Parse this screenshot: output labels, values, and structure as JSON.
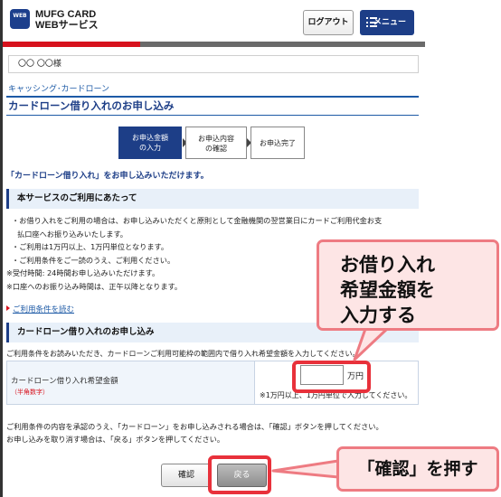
{
  "header": {
    "logo_badge": "WEB",
    "logo_line1": "MUFG CARD",
    "logo_line2": "WEBサービス",
    "logout_label": "ログアウト",
    "menu_label": "メニュー"
  },
  "user": {
    "name": "〇〇 〇〇様"
  },
  "breadcrumb": "キャッシング･カードローン",
  "page_title": "カードローン借り入れのお申し込み",
  "steps": [
    {
      "line1": "お申込金額",
      "line2": "の入力"
    },
    {
      "line1": "お申込内容",
      "line2": "の確認"
    },
    {
      "line1": "お申込完了",
      "line2": ""
    }
  ],
  "intro": "「カードローン借り入れ」をお申し込みいただけます。",
  "section1_title": "本サービスのご利用にあたって",
  "notes": [
    "・お借り入れをご利用の場合は、お申し込みいただくと原則として金融機関の翌営業日にカードご利用代金お支",
    "払口座へお振り込みいたします。",
    "・ご利用は1万円以上、1万円単位となります。",
    "・ご利用条件をご一読のうえ、ご利用ください。",
    "※受付時間: 24時間お申し込みいただけます。",
    "※口座へのお振り込み時間は、正午以降となります。"
  ],
  "terms_link": "ご利用条件を読む",
  "section2_title": "カードローン借り入れのお申し込み",
  "form_intro": "ご利用条件をお読みいただき、カードローンご利用可能枠の範囲内で借り入れ希望金額を入力してください。",
  "form": {
    "label": "カードローン借り入れ希望金額",
    "sublabel": "（半角数字）",
    "amount_value": "",
    "unit": "万円",
    "note": "※1万円以上、1万円単位で入力してください。"
  },
  "confirm_note_line1": "ご利用条件の内容を承認のうえ、「カードローン」をお申し込みされる場合は、「確認」ボタンを押してください。",
  "confirm_note_line2": "お申し込みを取り消す場合は、「戻る」ボタンを押してください。",
  "buttons": {
    "confirm": "確認",
    "back": "戻る"
  },
  "callout_input": [
    "お借り入れ",
    "希望金額を",
    "入力する"
  ],
  "callout_button": "「確認」を押す",
  "colors": {
    "accent_red": "#d7121d",
    "brand_navy": "#1d3e87",
    "highlight": "#e8313b",
    "callout_fill": "#fde5e5"
  }
}
